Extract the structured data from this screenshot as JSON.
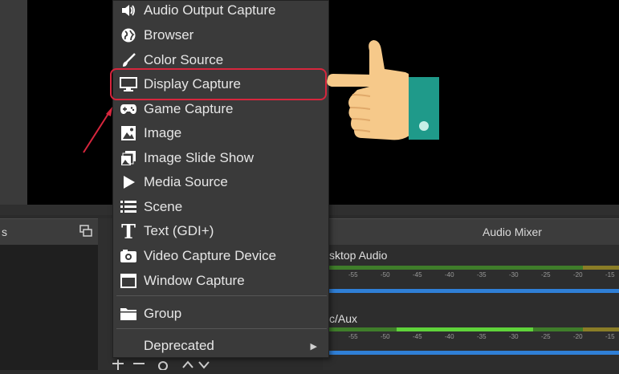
{
  "menu": {
    "items": [
      {
        "label": "Audio Output Capture",
        "icon": "speaker-icon"
      },
      {
        "label": "Browser",
        "icon": "globe-icon"
      },
      {
        "label": "Color Source",
        "icon": "brush-icon"
      },
      {
        "label": "Display Capture",
        "icon": "monitor-icon"
      },
      {
        "label": "Game Capture",
        "icon": "gamepad-icon"
      },
      {
        "label": "Image",
        "icon": "image-icon"
      },
      {
        "label": "Image Slide Show",
        "icon": "slideshow-icon"
      },
      {
        "label": "Media Source",
        "icon": "play-icon"
      },
      {
        "label": "Scene",
        "icon": "list-icon"
      },
      {
        "label": "Text (GDI+)",
        "icon": "text-icon"
      },
      {
        "label": "Video Capture Device",
        "icon": "camera-icon"
      },
      {
        "label": "Window Capture",
        "icon": "window-icon"
      }
    ],
    "group_label": "Group",
    "deprecated_label": "Deprecated",
    "highlighted_item": "Display Capture"
  },
  "docks": {
    "left_title_fragment": "s",
    "mixer_title": "Audio Mixer",
    "mixer_tracks": [
      {
        "label": "sktop Audio"
      },
      {
        "label": "c/Aux"
      }
    ],
    "scale_ticks": [
      "-55",
      "-50",
      "-45",
      "-40",
      "-35",
      "-30",
      "-25",
      "-20",
      "-15"
    ]
  },
  "colors": {
    "highlight": "#d7263d",
    "meter_green": "#4caf2f",
    "meter_yellow": "#b9a72a",
    "meter_blue": "#2f7fd6",
    "hand_skin": "#f6c98a",
    "sleeve": "#1f9a8a"
  }
}
